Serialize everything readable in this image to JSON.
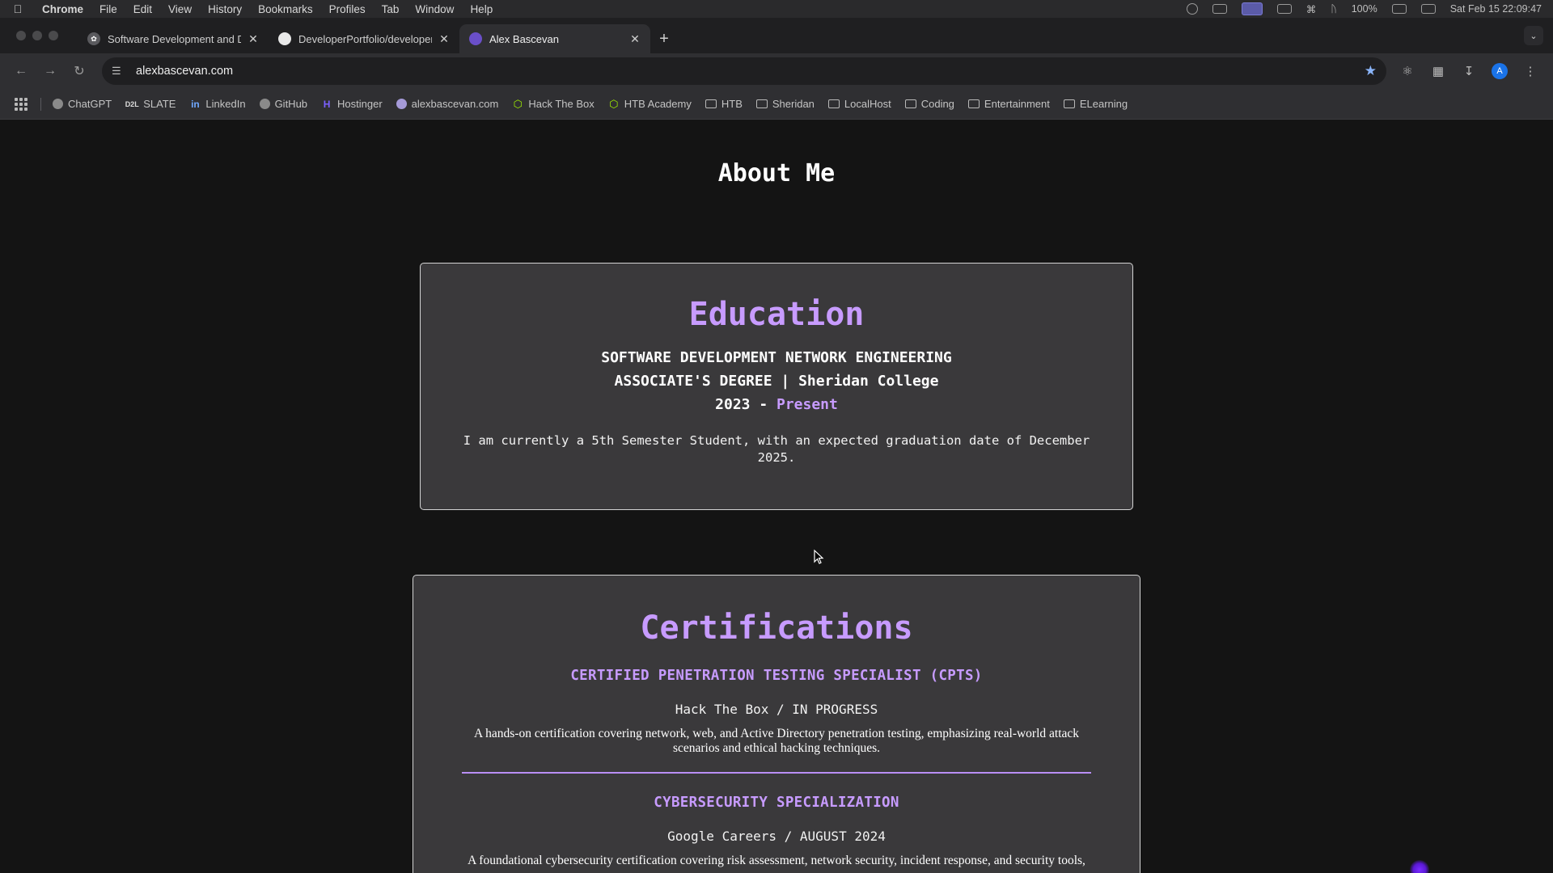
{
  "menubar": {
    "app": "Chrome",
    "items": [
      "File",
      "Edit",
      "View",
      "History",
      "Bookmarks",
      "Profiles",
      "Tab",
      "Window",
      "Help"
    ],
    "battery": "100%",
    "clock": "Sat Feb 15  22:09:47"
  },
  "tabs": [
    {
      "title": "Software Development and D",
      "icon": "chatgpt-icon"
    },
    {
      "title": "DeveloperPortfolio/developer",
      "icon": "github-icon"
    },
    {
      "title": "Alex Bascevan",
      "icon": "site-favicon"
    }
  ],
  "toolbar": {
    "url": "alexbascevan.com",
    "avatar": "A"
  },
  "bookmarks": [
    {
      "label": "ChatGPT",
      "icon": "chatgpt-icon"
    },
    {
      "label": "SLATE",
      "icon": "slate-icon"
    },
    {
      "label": "LinkedIn",
      "icon": "linkedin-icon"
    },
    {
      "label": "GitHub",
      "icon": "github-icon"
    },
    {
      "label": "Hostinger",
      "icon": "hostinger-icon"
    },
    {
      "label": "alexbascevan.com",
      "icon": "site-icon"
    },
    {
      "label": "Hack The Box",
      "icon": "htb-icon"
    },
    {
      "label": "HTB Academy",
      "icon": "htb-icon"
    },
    {
      "label": "HTB",
      "icon": "folder-icon"
    },
    {
      "label": "Sheridan",
      "icon": "folder-icon"
    },
    {
      "label": "LocalHost",
      "icon": "folder-icon"
    },
    {
      "label": "Coding",
      "icon": "folder-icon"
    },
    {
      "label": "Entertainment",
      "icon": "folder-icon"
    },
    {
      "label": "ELearning",
      "icon": "folder-icon"
    }
  ],
  "page": {
    "heading": "About Me",
    "education": {
      "title": "Education",
      "line1": "SOFTWARE DEVELOPMENT NETWORK ENGINEERING",
      "line2": "ASSOCIATE'S DEGREE | Sheridan College",
      "year": "2023 - ",
      "status": "Present",
      "description": "I am currently a 5th Semester Student, with an expected graduation date of December 2025."
    },
    "certifications": {
      "title": "Certifications",
      "items": [
        {
          "name": "CERTIFIED PENETRATION TESTING SPECIALIST (CPTS)",
          "issuer": "Hack The Box / IN PROGRESS",
          "description": "A hands-on certification covering network, web, and Active Directory penetration testing, emphasizing real-world attack scenarios and ethical hacking techniques."
        },
        {
          "name": "CYBERSECURITY SPECIALIZATION",
          "issuer": "Google Careers / AUGUST 2024",
          "description": "A foundational cybersecurity certification covering risk assessment, network security, incident response, and security tools,"
        }
      ]
    }
  },
  "colors": {
    "accent": "#c79bff",
    "card_bg": "#3a393b",
    "page_bg": "#141414"
  }
}
